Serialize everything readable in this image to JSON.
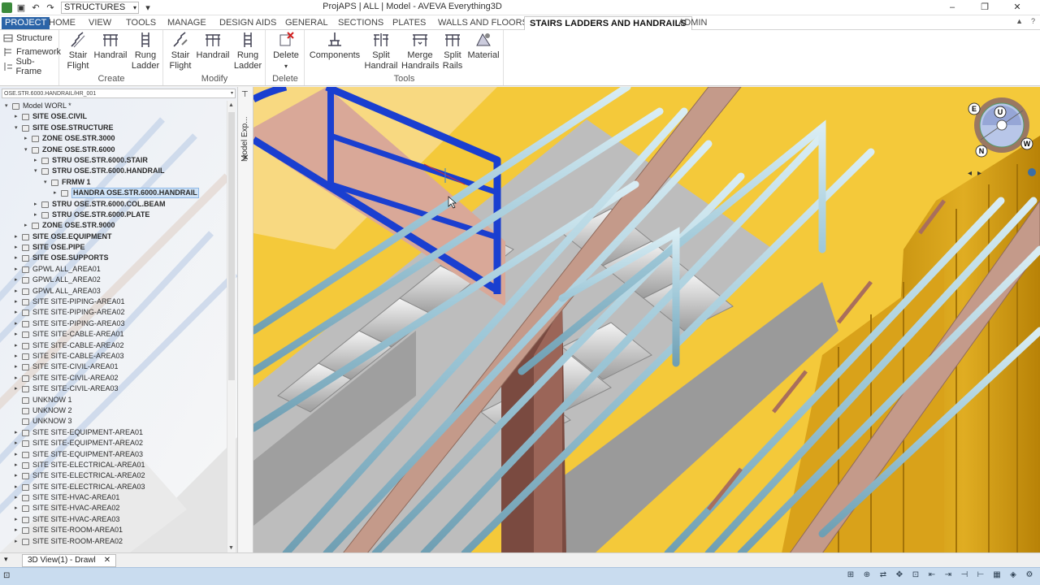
{
  "app": {
    "window_title": "ProjAPS | ALL | Model - AVEVA Everything3D",
    "module": "STRUCTURES",
    "window_controls": [
      "–",
      "❐",
      "✕"
    ]
  },
  "ribbon_tabs": [
    {
      "label": "PROJECT"
    },
    {
      "label": "HOME"
    },
    {
      "label": "VIEW"
    },
    {
      "label": "TOOLS"
    },
    {
      "label": "MANAGE"
    },
    {
      "label": "DESIGN AIDS"
    },
    {
      "label": "GENERAL"
    },
    {
      "label": "SECTIONS"
    },
    {
      "label": "PLATES"
    },
    {
      "label": "WALLS AND FLOORS"
    },
    {
      "label": "STAIRS LADDERS AND HANDRAILS"
    },
    {
      "label": "ADMIN"
    }
  ],
  "active_tab": "STAIRS LADDERS AND HANDRAILS",
  "ribbon": {
    "quick": {
      "structure": "Structure",
      "framework": "Framework",
      "subframe": "Sub-Frame"
    },
    "create": {
      "label": "Create",
      "stair_flight_1": "Stair",
      "stair_flight_2": "Flight",
      "handrail": "Handrail",
      "rung_1": "Rung",
      "rung_2": "Ladder"
    },
    "modify": {
      "label": "Modify",
      "stair_flight_1": "Stair",
      "stair_flight_2": "Flight",
      "handrail": "Handrail",
      "rung_1": "Rung",
      "rung_2": "Ladder"
    },
    "delete": {
      "label": "Delete",
      "delete": "Delete"
    },
    "tools": {
      "label": "Tools",
      "components": "Components",
      "split_handrail_1": "Split",
      "split_handrail_2": "Handrail",
      "merge_1": "Merge",
      "merge_2": "Handrails",
      "split_rails_1": "Split",
      "split_rails_2": "Rails",
      "material": "Material"
    }
  },
  "explorer": {
    "current": "OSE.STR.6000.HANDRAIL/HR_001",
    "panel_title": "Model Exp...",
    "tree": [
      {
        "label": "Model WORL *",
        "indent": 0,
        "tw": "▾",
        "bold": false
      },
      {
        "label": "SITE OSE.CIVIL",
        "indent": 1,
        "tw": "▸",
        "bold": true
      },
      {
        "label": "SITE OSE.STRUCTURE",
        "indent": 1,
        "tw": "▾",
        "bold": true
      },
      {
        "label": "ZONE OSE.STR.3000",
        "indent": 2,
        "tw": "▸",
        "bold": true
      },
      {
        "label": "ZONE OSE.STR.6000",
        "indent": 2,
        "tw": "▾",
        "bold": true
      },
      {
        "label": "STRU OSE.STR.6000.STAIR",
        "indent": 3,
        "tw": "▸",
        "bold": true
      },
      {
        "label": "STRU OSE.STR.6000.HANDRAIL",
        "indent": 3,
        "tw": "▾",
        "bold": true
      },
      {
        "label": "FRMW 1",
        "indent": 4,
        "tw": "▾",
        "bold": true
      },
      {
        "label": "HANDRA OSE.STR.6000.HANDRAIL",
        "indent": 5,
        "tw": "▸",
        "bold": true,
        "sel": true
      },
      {
        "label": "STRU OSE.STR.6000.COL.BEAM",
        "indent": 3,
        "tw": "▸",
        "bold": true
      },
      {
        "label": "STRU OSE.STR.6000.PLATE",
        "indent": 3,
        "tw": "▸",
        "bold": true
      },
      {
        "label": "ZONE OSE.STR.9000",
        "indent": 2,
        "tw": "▸",
        "bold": true
      },
      {
        "label": "SITE OSE.EQUIPMENT",
        "indent": 1,
        "tw": "▸",
        "bold": true
      },
      {
        "label": "SITE OSE.PIPE",
        "indent": 1,
        "tw": "▸",
        "bold": true
      },
      {
        "label": "SITE OSE.SUPPORTS",
        "indent": 1,
        "tw": "▸",
        "bold": true
      },
      {
        "label": "GPWL ALL_AREA01",
        "indent": 1,
        "tw": "▸",
        "bold": false
      },
      {
        "label": "GPWL ALL_AREA02",
        "indent": 1,
        "tw": "▸",
        "bold": false
      },
      {
        "label": "GPWL ALL_AREA03",
        "indent": 1,
        "tw": "▸",
        "bold": false
      },
      {
        "label": "SITE SITE-PIPING-AREA01",
        "indent": 1,
        "tw": "▸",
        "bold": false
      },
      {
        "label": "SITE SITE-PIPING-AREA02",
        "indent": 1,
        "tw": "▸",
        "bold": false
      },
      {
        "label": "SITE SITE-PIPING-AREA03",
        "indent": 1,
        "tw": "▸",
        "bold": false
      },
      {
        "label": "SITE SITE-CABLE-AREA01",
        "indent": 1,
        "tw": "▸",
        "bold": false
      },
      {
        "label": "SITE SITE-CABLE-AREA02",
        "indent": 1,
        "tw": "▸",
        "bold": false
      },
      {
        "label": "SITE SITE-CABLE-AREA03",
        "indent": 1,
        "tw": "▸",
        "bold": false
      },
      {
        "label": "SITE SITE-CIVIL-AREA01",
        "indent": 1,
        "tw": "▸",
        "bold": false
      },
      {
        "label": "SITE SITE-CIVIL-AREA02",
        "indent": 1,
        "tw": "▸",
        "bold": false
      },
      {
        "label": "SITE SITE-CIVIL-AREA03",
        "indent": 1,
        "tw": "▸",
        "bold": false
      },
      {
        "label": "UNKNOW 1",
        "indent": 1,
        "tw": "",
        "bold": false
      },
      {
        "label": "UNKNOW 2",
        "indent": 1,
        "tw": "",
        "bold": false
      },
      {
        "label": "UNKNOW 3",
        "indent": 1,
        "tw": "",
        "bold": false
      },
      {
        "label": "SITE SITE-EQUIPMENT-AREA01",
        "indent": 1,
        "tw": "▸",
        "bold": false
      },
      {
        "label": "SITE SITE-EQUIPMENT-AREA02",
        "indent": 1,
        "tw": "▸",
        "bold": false
      },
      {
        "label": "SITE SITE-EQUIPMENT-AREA03",
        "indent": 1,
        "tw": "▸",
        "bold": false
      },
      {
        "label": "SITE SITE-ELECTRICAL-AREA01",
        "indent": 1,
        "tw": "▸",
        "bold": false
      },
      {
        "label": "SITE SITE-ELECTRICAL-AREA02",
        "indent": 1,
        "tw": "▸",
        "bold": false
      },
      {
        "label": "SITE SITE-ELECTRICAL-AREA03",
        "indent": 1,
        "tw": "▸",
        "bold": false
      },
      {
        "label": "SITE SITE-HVAC-AREA01",
        "indent": 1,
        "tw": "▸",
        "bold": false
      },
      {
        "label": "SITE SITE-HVAC-AREA02",
        "indent": 1,
        "tw": "▸",
        "bold": false
      },
      {
        "label": "SITE SITE-HVAC-AREA03",
        "indent": 1,
        "tw": "▸",
        "bold": false
      },
      {
        "label": "SITE SITE-ROOM-AREA01",
        "indent": 1,
        "tw": "▸",
        "bold": false
      },
      {
        "label": "SITE SITE-ROOM-AREA02",
        "indent": 1,
        "tw": "▸",
        "bold": false
      }
    ]
  },
  "viewcube": {
    "u": "U",
    "e": "E",
    "n": "N",
    "w": "W"
  },
  "doc_tab": {
    "label": "3D View(1) - Drawl",
    "close": "✕"
  },
  "colors": {
    "accent": "#2b64a8",
    "rail": "#9fc8d8",
    "selected_rail": "#1a3fd0",
    "stringer": "#c49a8a",
    "background": "#f4c93a",
    "wall": "#d4a019"
  }
}
